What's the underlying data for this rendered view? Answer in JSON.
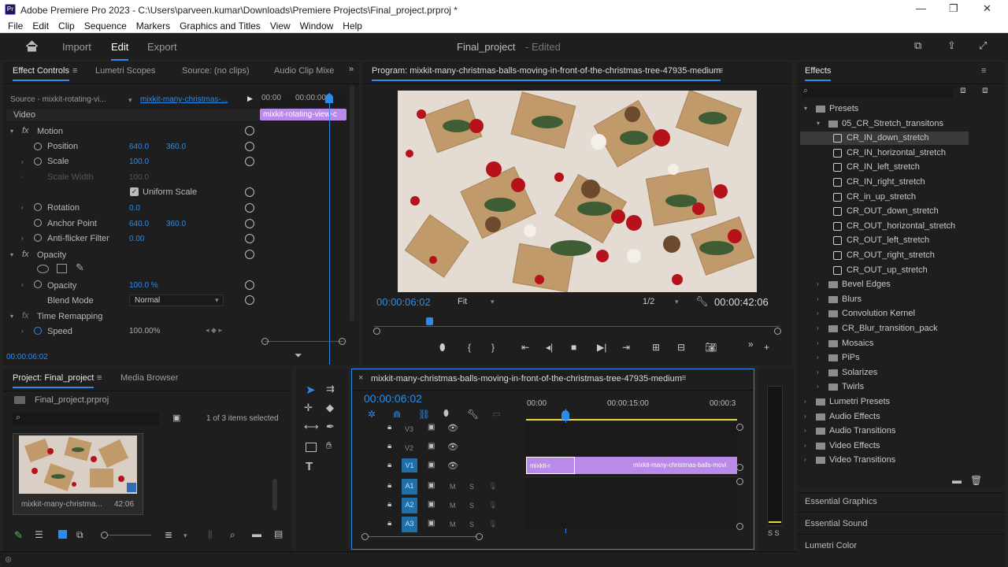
{
  "window": {
    "title": "Adobe Premiere Pro 2023 - C:\\Users\\parveen.kumar\\Downloads\\Premiere Projects\\Final_project.prproj *",
    "app_badge": "Pr"
  },
  "menu": [
    "File",
    "Edit",
    "Clip",
    "Sequence",
    "Markers",
    "Graphics and Titles",
    "View",
    "Window",
    "Help"
  ],
  "header": {
    "tabs": [
      "Import",
      "Edit",
      "Export"
    ],
    "active_tab": "Edit",
    "project_name": "Final_project",
    "status": "- Edited"
  },
  "effect_controls": {
    "tabs": [
      "Effect Controls",
      "Lumetri Scopes",
      "Source: (no clips)",
      "Audio Clip Mixe"
    ],
    "source_label": "Source - mixkit-rotating-vi...",
    "sequence_label": "mixkit-many-christmas-...",
    "timecodes": [
      "00:00",
      "00:00:00"
    ],
    "clip_label": "mixkit-rotating-view-c",
    "section": "Video",
    "motion": "Motion",
    "position": {
      "label": "Position",
      "x": "640.0",
      "y": "360.0"
    },
    "scale": {
      "label": "Scale",
      "value": "100.0"
    },
    "scale_width": {
      "label": "Scale Width",
      "value": "100.0"
    },
    "uniform_scale": "Uniform Scale",
    "rotation": {
      "label": "Rotation",
      "value": "0.0"
    },
    "anchor_point": {
      "label": "Anchor Point",
      "x": "640.0",
      "y": "360.0"
    },
    "anti_flicker": {
      "label": "Anti-flicker Filter",
      "value": "0.00"
    },
    "opacity_section": "Opacity",
    "opacity": {
      "label": "Opacity",
      "value": "100.0 %"
    },
    "blend_mode": {
      "label": "Blend Mode",
      "value": "Normal"
    },
    "time_remapping": "Time Remapping",
    "speed": {
      "label": "Speed",
      "value": "100.00%"
    },
    "current_time": "00:00:06:02"
  },
  "program": {
    "title": "Program: mixkit-many-christmas-balls-moving-in-front-of-the-christmas-tree-47935-medium",
    "timecode": "00:00:06:02",
    "fit": "Fit",
    "resolution": "1/2",
    "duration": "00:00:42:06"
  },
  "effects": {
    "title": "Effects",
    "tree": [
      {
        "label": "Presets",
        "level": 0,
        "type": "folder",
        "open": true
      },
      {
        "label": "05_CR_Stretch_transitons",
        "level": 1,
        "type": "folder",
        "open": true
      },
      {
        "label": "CR_IN_down_stretch",
        "level": 2,
        "type": "preset",
        "selected": true
      },
      {
        "label": "CR_IN_horizontal_stretch",
        "level": 2,
        "type": "preset"
      },
      {
        "label": "CR_IN_left_stretch",
        "level": 2,
        "type": "preset"
      },
      {
        "label": "CR_IN_right_stretch",
        "level": 2,
        "type": "preset"
      },
      {
        "label": "CR_in_up_stretch",
        "level": 2,
        "type": "preset"
      },
      {
        "label": "CR_OUT_down_stretch",
        "level": 2,
        "type": "preset"
      },
      {
        "label": "CR_OUT_horizontal_stretch",
        "level": 2,
        "type": "preset"
      },
      {
        "label": "CR_OUT_left_stretch",
        "level": 2,
        "type": "preset"
      },
      {
        "label": "CR_OUT_right_stretch",
        "level": 2,
        "type": "preset"
      },
      {
        "label": "CR_OUT_up_stretch",
        "level": 2,
        "type": "preset"
      },
      {
        "label": "Bevel Edges",
        "level": 1,
        "type": "folder"
      },
      {
        "label": "Blurs",
        "level": 1,
        "type": "folder"
      },
      {
        "label": "Convolution Kernel",
        "level": 1,
        "type": "folder"
      },
      {
        "label": "CR_Blur_transition_pack",
        "level": 1,
        "type": "folder"
      },
      {
        "label": "Mosaics",
        "level": 1,
        "type": "folder"
      },
      {
        "label": "PiPs",
        "level": 1,
        "type": "folder"
      },
      {
        "label": "Solarizes",
        "level": 1,
        "type": "folder"
      },
      {
        "label": "Twirls",
        "level": 1,
        "type": "folder"
      },
      {
        "label": "Lumetri Presets",
        "level": 0,
        "type": "folder"
      },
      {
        "label": "Audio Effects",
        "level": 0,
        "type": "folder"
      },
      {
        "label": "Audio Transitions",
        "level": 0,
        "type": "folder"
      },
      {
        "label": "Video Effects",
        "level": 0,
        "type": "folder"
      },
      {
        "label": "Video Transitions",
        "level": 0,
        "type": "folder"
      }
    ],
    "bottom_panels": [
      "Essential Graphics",
      "Essential Sound",
      "Lumetri Color"
    ]
  },
  "project": {
    "tabs": [
      "Project: Final_project",
      "Media Browser"
    ],
    "file": "Final_project.prproj",
    "items_selected": "1 of 3 items selected",
    "thumb_name": "mixkit-many-christma...",
    "thumb_duration": "42:06"
  },
  "timeline": {
    "title": "mixkit-many-christmas-balls-moving-in-front-of-the-christmas-tree-47935-medium",
    "timecode": "00:00:06:02",
    "ruler": [
      "00:00",
      "00:00:15:00",
      "00:00:3"
    ],
    "video_tracks": [
      "V3",
      "V2",
      "V1"
    ],
    "audio_tracks": [
      "A1",
      "A2",
      "A3"
    ],
    "clip1": "mixkit-r",
    "clip2": "mixkit-many-christmas-balls-movi"
  },
  "audio_meter": {
    "labels": "S S"
  },
  "colors": {
    "accent": "#2d8ceb",
    "clip": "#b98ae8",
    "panel": "#1e1e1e"
  }
}
